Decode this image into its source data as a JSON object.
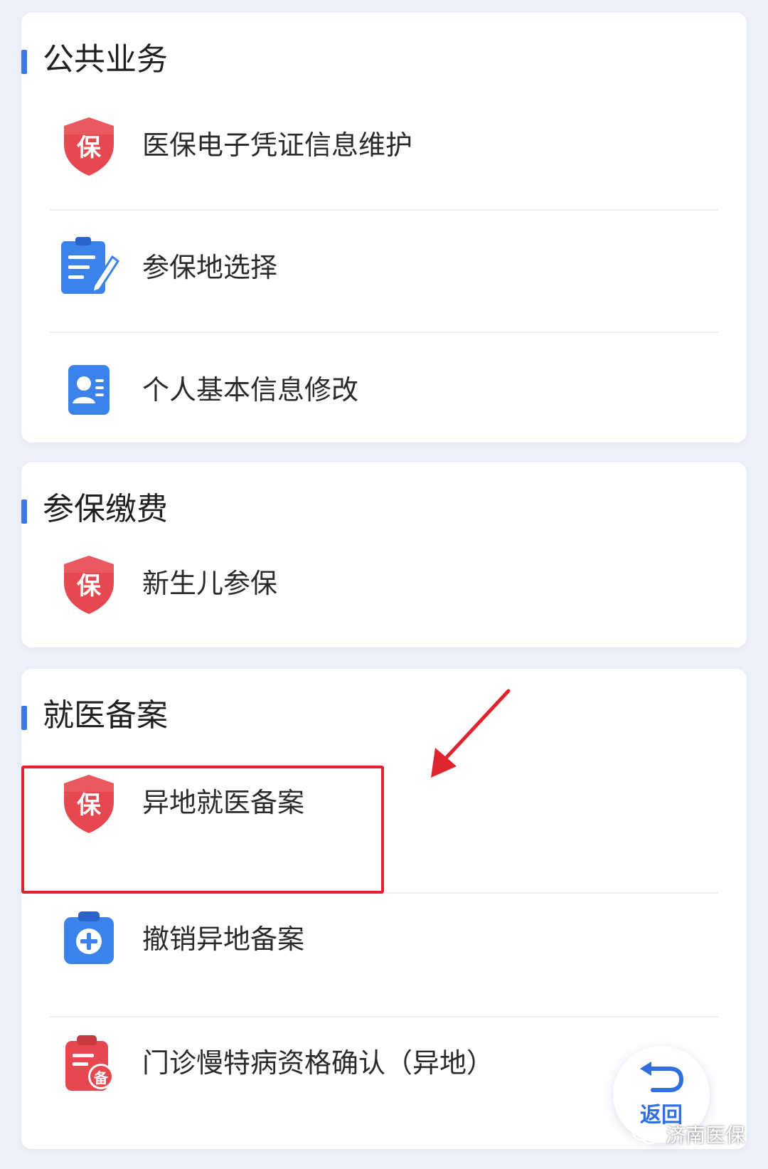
{
  "sections": [
    {
      "title": "公共业务",
      "items": [
        {
          "label": "医保电子凭证信息维护",
          "icon": "insurance-shield-icon"
        },
        {
          "label": "参保地选择",
          "icon": "edit-document-icon"
        },
        {
          "label": "个人基本信息修改",
          "icon": "profile-card-icon"
        }
      ]
    },
    {
      "title": "参保缴费",
      "items": [
        {
          "label": "新生儿参保",
          "icon": "insurance-shield-icon"
        }
      ]
    },
    {
      "title": "就医备案",
      "items": [
        {
          "label": "异地就医备案",
          "icon": "insurance-shield-icon",
          "highlighted": true
        },
        {
          "label": "撤销异地备案",
          "icon": "medical-clipboard-icon"
        },
        {
          "label": "门诊慢特病资格确认（异地）",
          "icon": "filing-clipboard-icon"
        }
      ]
    }
  ],
  "icon_text": {
    "shield": "保",
    "filing": "备"
  },
  "back_button": {
    "label": "返回",
    "icon": "back-arrow-icon"
  },
  "watermark": {
    "text": "济南医保",
    "icon": "wechat-icon"
  },
  "colors": {
    "background": "#eef1f8",
    "accent_blue": "#3b78e7",
    "shield_red": "#e5484f",
    "highlight_red": "#e0242f"
  }
}
